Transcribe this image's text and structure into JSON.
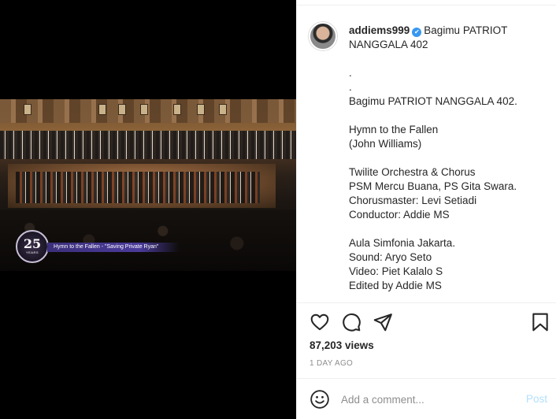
{
  "video": {
    "badge_number": "25",
    "badge_text": "YEARS",
    "caption_overlay": "Hymn to the Fallen - \"Saving Private Ryan\""
  },
  "post": {
    "username": "addiems999",
    "verified_icon": "verified-badge-icon",
    "caption_lines": [
      "Bagimu PATRIOT",
      "NANGGALA 402",
      "",
      ".",
      ".",
      "Bagimu PATRIOT NANGGALA 402.",
      "",
      "Hymn to the Fallen",
      "(John Williams)",
      "",
      "Twilite Orchestra & Chorus",
      "PSM Mercu Buana, PS Gita Swara.",
      "Chorusmaster: Levi Setiadi",
      "Conductor: Addie MS",
      "",
      "Aula Simfonia Jakarta.",
      "Sound: Aryo Seto",
      "Video: Piet Kalalo S",
      "Edited by Addie MS"
    ],
    "views": "87,203 views",
    "timestamp": "1 DAY AGO"
  },
  "actions": {
    "like_icon": "heart-icon",
    "comment_icon": "comment-bubble-icon",
    "share_icon": "paper-plane-icon",
    "save_icon": "bookmark-icon"
  },
  "comment_box": {
    "emoji_icon": "smiley-icon",
    "placeholder": "Add a comment...",
    "post_label": "Post"
  },
  "colors": {
    "verified": "#3897f0",
    "post_button_disabled": "#b2dffc",
    "muted_text": "#8e8e8e",
    "caption_overlay_bar": "#4a3b9a"
  }
}
